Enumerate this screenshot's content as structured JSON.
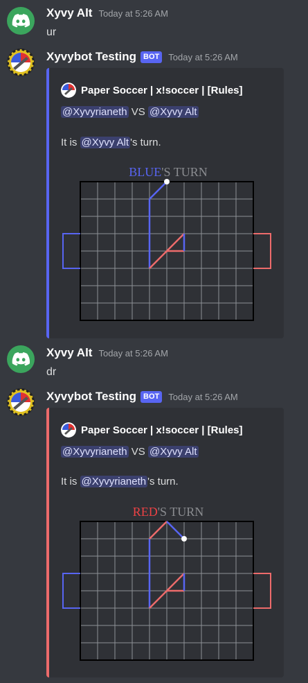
{
  "messages": [
    {
      "username": "Xyvy Alt",
      "timestamp": "Today at 5:26 AM",
      "content": "ur"
    },
    {
      "username": "Xyvybot Testing",
      "bot_tag": "BOT",
      "timestamp": "Today at 5:26 AM",
      "embed": {
        "accent_color": "#5865f2",
        "author": "Paper Soccer | x!soccer | [Rules]",
        "player1": "@Xyvyrianeth",
        "vs": "VS",
        "player2": "@Xyvy Alt",
        "turn_prefix": "It is ",
        "turn_mention": "@Xyvy Alt",
        "turn_suffix": "'s turn.",
        "board_label_color": "BLUE",
        "board_label_rest": "'S TURN"
      }
    },
    {
      "username": "Xyvy Alt",
      "timestamp": "Today at 5:26 AM",
      "content": "dr"
    },
    {
      "username": "Xyvybot Testing",
      "bot_tag": "BOT",
      "timestamp": "Today at 5:26 AM",
      "embed": {
        "accent_color": "#ed6b6b",
        "author": "Paper Soccer | x!soccer | [Rules]",
        "player1": "@Xyvyrianeth",
        "vs": "VS",
        "player2": "@Xyvy Alt",
        "turn_prefix": "It is ",
        "turn_mention": "@Xyvyrianeth",
        "turn_suffix": "'s turn.",
        "board_label_color": "RED",
        "board_label_rest": "'S TURN"
      }
    }
  ],
  "colors": {
    "blue_team": "#5865f2",
    "red_team": "#ed6b6b",
    "bot_tag": "#5865f2",
    "discord_green": "#3ba55d"
  }
}
